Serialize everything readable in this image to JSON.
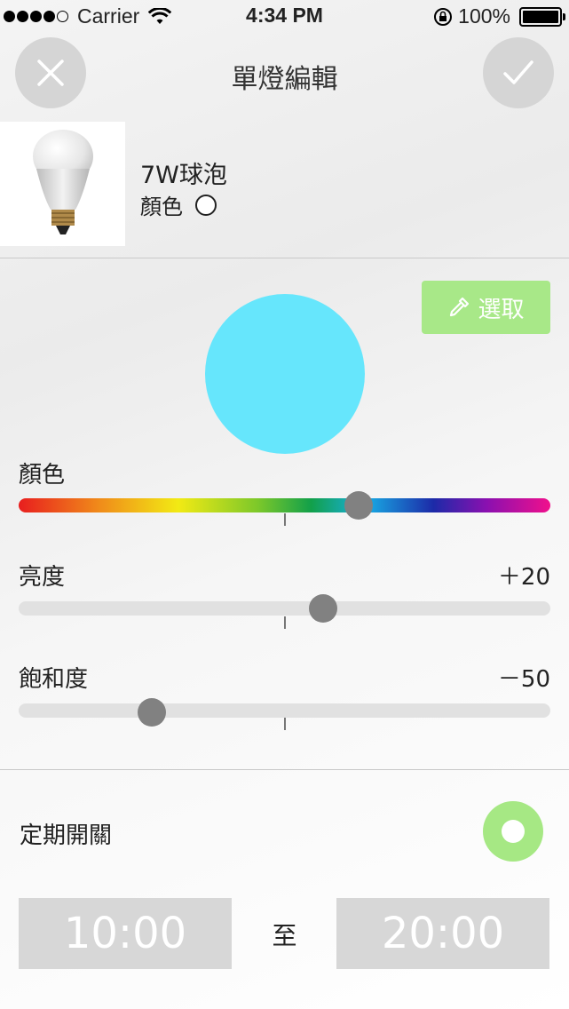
{
  "status_bar": {
    "carrier": "Carrier",
    "time": "4:34 PM",
    "battery": "100%",
    "signal_bars": 4
  },
  "nav": {
    "title": "單燈編輯",
    "close_icon": "close-icon",
    "confirm_icon": "checkmark-icon"
  },
  "product": {
    "name": "7W球泡",
    "color_label": "顏色",
    "color_swatch": "#ffffff"
  },
  "color_picker": {
    "pick_label": "選取",
    "pick_icon": "eyedropper-icon",
    "preview_color": "#66e6fc",
    "pick_button_color": "#a8e888"
  },
  "sliders": {
    "hue": {
      "label": "顏色",
      "position": 0.64
    },
    "brightness": {
      "label": "亮度",
      "value": "＋20",
      "position": 0.573
    },
    "saturation": {
      "label": "飽和度",
      "value": "－50",
      "position": 0.251
    }
  },
  "schedule": {
    "label": "定期開關",
    "enabled": true,
    "toggle_color": "#a6e884",
    "start": "10:00",
    "separator": "至",
    "end": "20:00"
  }
}
